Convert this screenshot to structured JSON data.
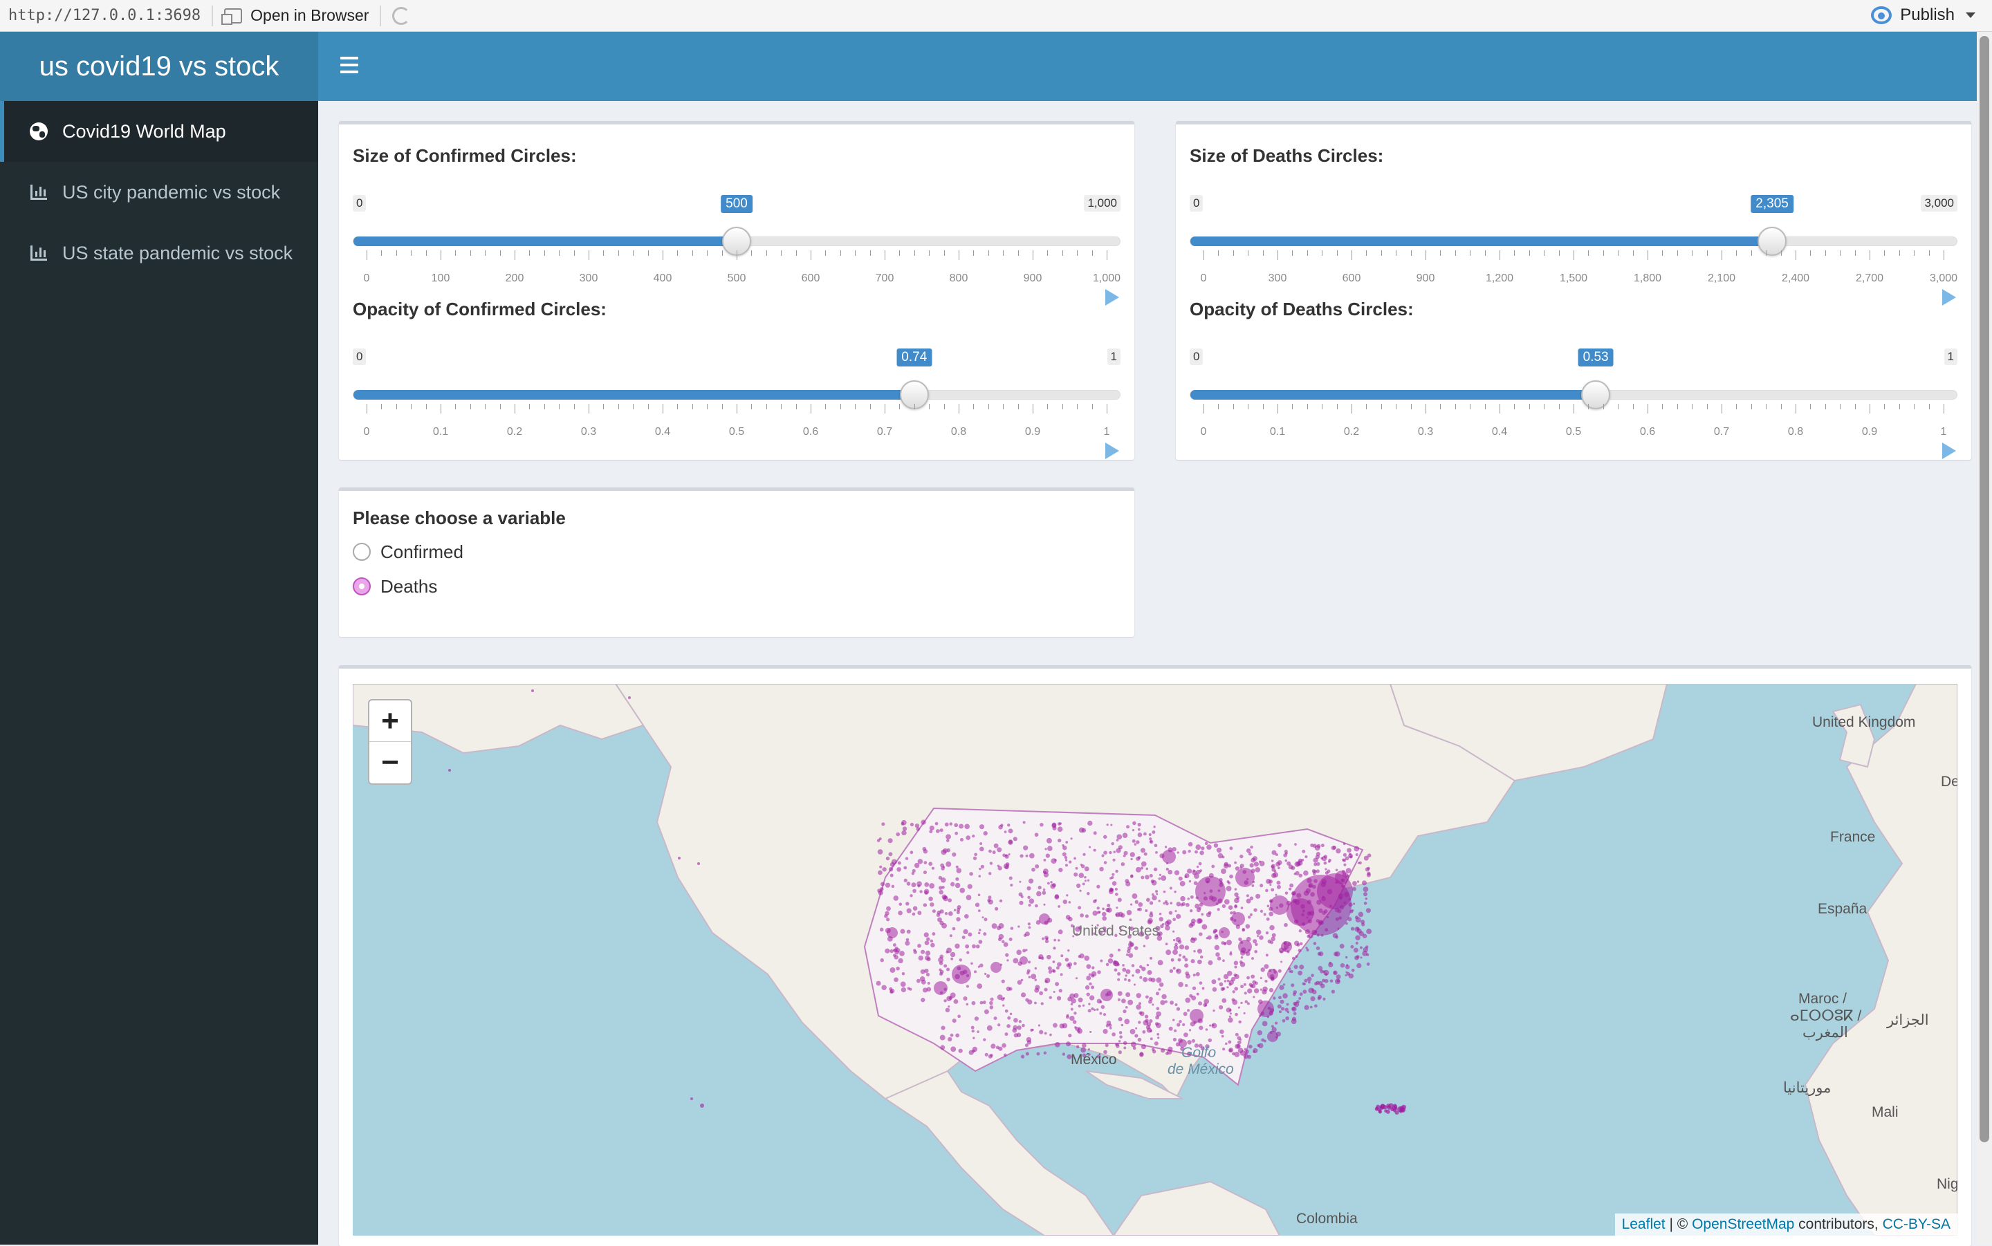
{
  "viewer": {
    "url": "http://127.0.0.1:3698",
    "open_label": "Open in Browser",
    "publish_label": "Publish"
  },
  "header": {
    "title": "us covid19 vs stock"
  },
  "sidebar": {
    "items": [
      {
        "label": "Covid19 World Map",
        "icon": "globe-icon",
        "active": true
      },
      {
        "label": "US city pandemic vs stock",
        "icon": "bar-chart-icon",
        "active": false
      },
      {
        "label": "US state pandemic vs stock",
        "icon": "bar-chart-icon",
        "active": false
      }
    ]
  },
  "sliders": {
    "confirmed_size": {
      "label": "Size of Confirmed Circles:",
      "min": "0",
      "max": "1,000",
      "value": "500",
      "fraction": 0.5,
      "ticks": [
        "0",
        "100",
        "200",
        "300",
        "400",
        "500",
        "600",
        "700",
        "800",
        "900",
        "1,000"
      ]
    },
    "confirmed_opacity": {
      "label": "Opacity of Confirmed Circles:",
      "min": "0",
      "max": "1",
      "value": "0.74",
      "fraction": 0.74,
      "ticks": [
        "0",
        "0.1",
        "0.2",
        "0.3",
        "0.4",
        "0.5",
        "0.6",
        "0.7",
        "0.8",
        "0.9",
        "1"
      ]
    },
    "deaths_size": {
      "label": "Size of Deaths Circles:",
      "min": "0",
      "max": "3,000",
      "value": "2,305",
      "fraction": 0.7683,
      "ticks": [
        "0",
        "300",
        "600",
        "900",
        "1,200",
        "1,500",
        "1,800",
        "2,100",
        "2,400",
        "2,700",
        "3,000"
      ]
    },
    "deaths_opacity": {
      "label": "Opacity of Deaths Circles:",
      "min": "0",
      "max": "1",
      "value": "0.53",
      "fraction": 0.53,
      "ticks": [
        "0",
        "0.1",
        "0.2",
        "0.3",
        "0.4",
        "0.5",
        "0.6",
        "0.7",
        "0.8",
        "0.9",
        "1"
      ]
    }
  },
  "variable": {
    "label": "Please choose a variable",
    "options": [
      "Confirmed",
      "Deaths"
    ],
    "selected": "Deaths"
  },
  "map": {
    "zoom_in": "+",
    "zoom_out": "−",
    "labels": {
      "united_kingdom": "United Kingdom",
      "france": "France",
      "espana": "España",
      "maroc": "Maroc /",
      "maroc_berber": "ⴰⵎⵔⵔⵓⴽ /",
      "maroc_ar": "المغرب",
      "algeria": "الجزائر",
      "mauritania": "موريتانيا",
      "mali": "Mali",
      "mexico": "México",
      "golfo": "Golfo",
      "de_mexico": "de México",
      "united_states": "United States",
      "colombia": "Colombia",
      "de": "De",
      "nig": "Nig"
    },
    "attribution": {
      "leaflet": "Leaflet",
      "sep": " | © ",
      "osm": "OpenStreetMap",
      "contrib": " contributors, ",
      "license": "CC-BY-SA"
    },
    "circle_color": "#a020a0"
  }
}
